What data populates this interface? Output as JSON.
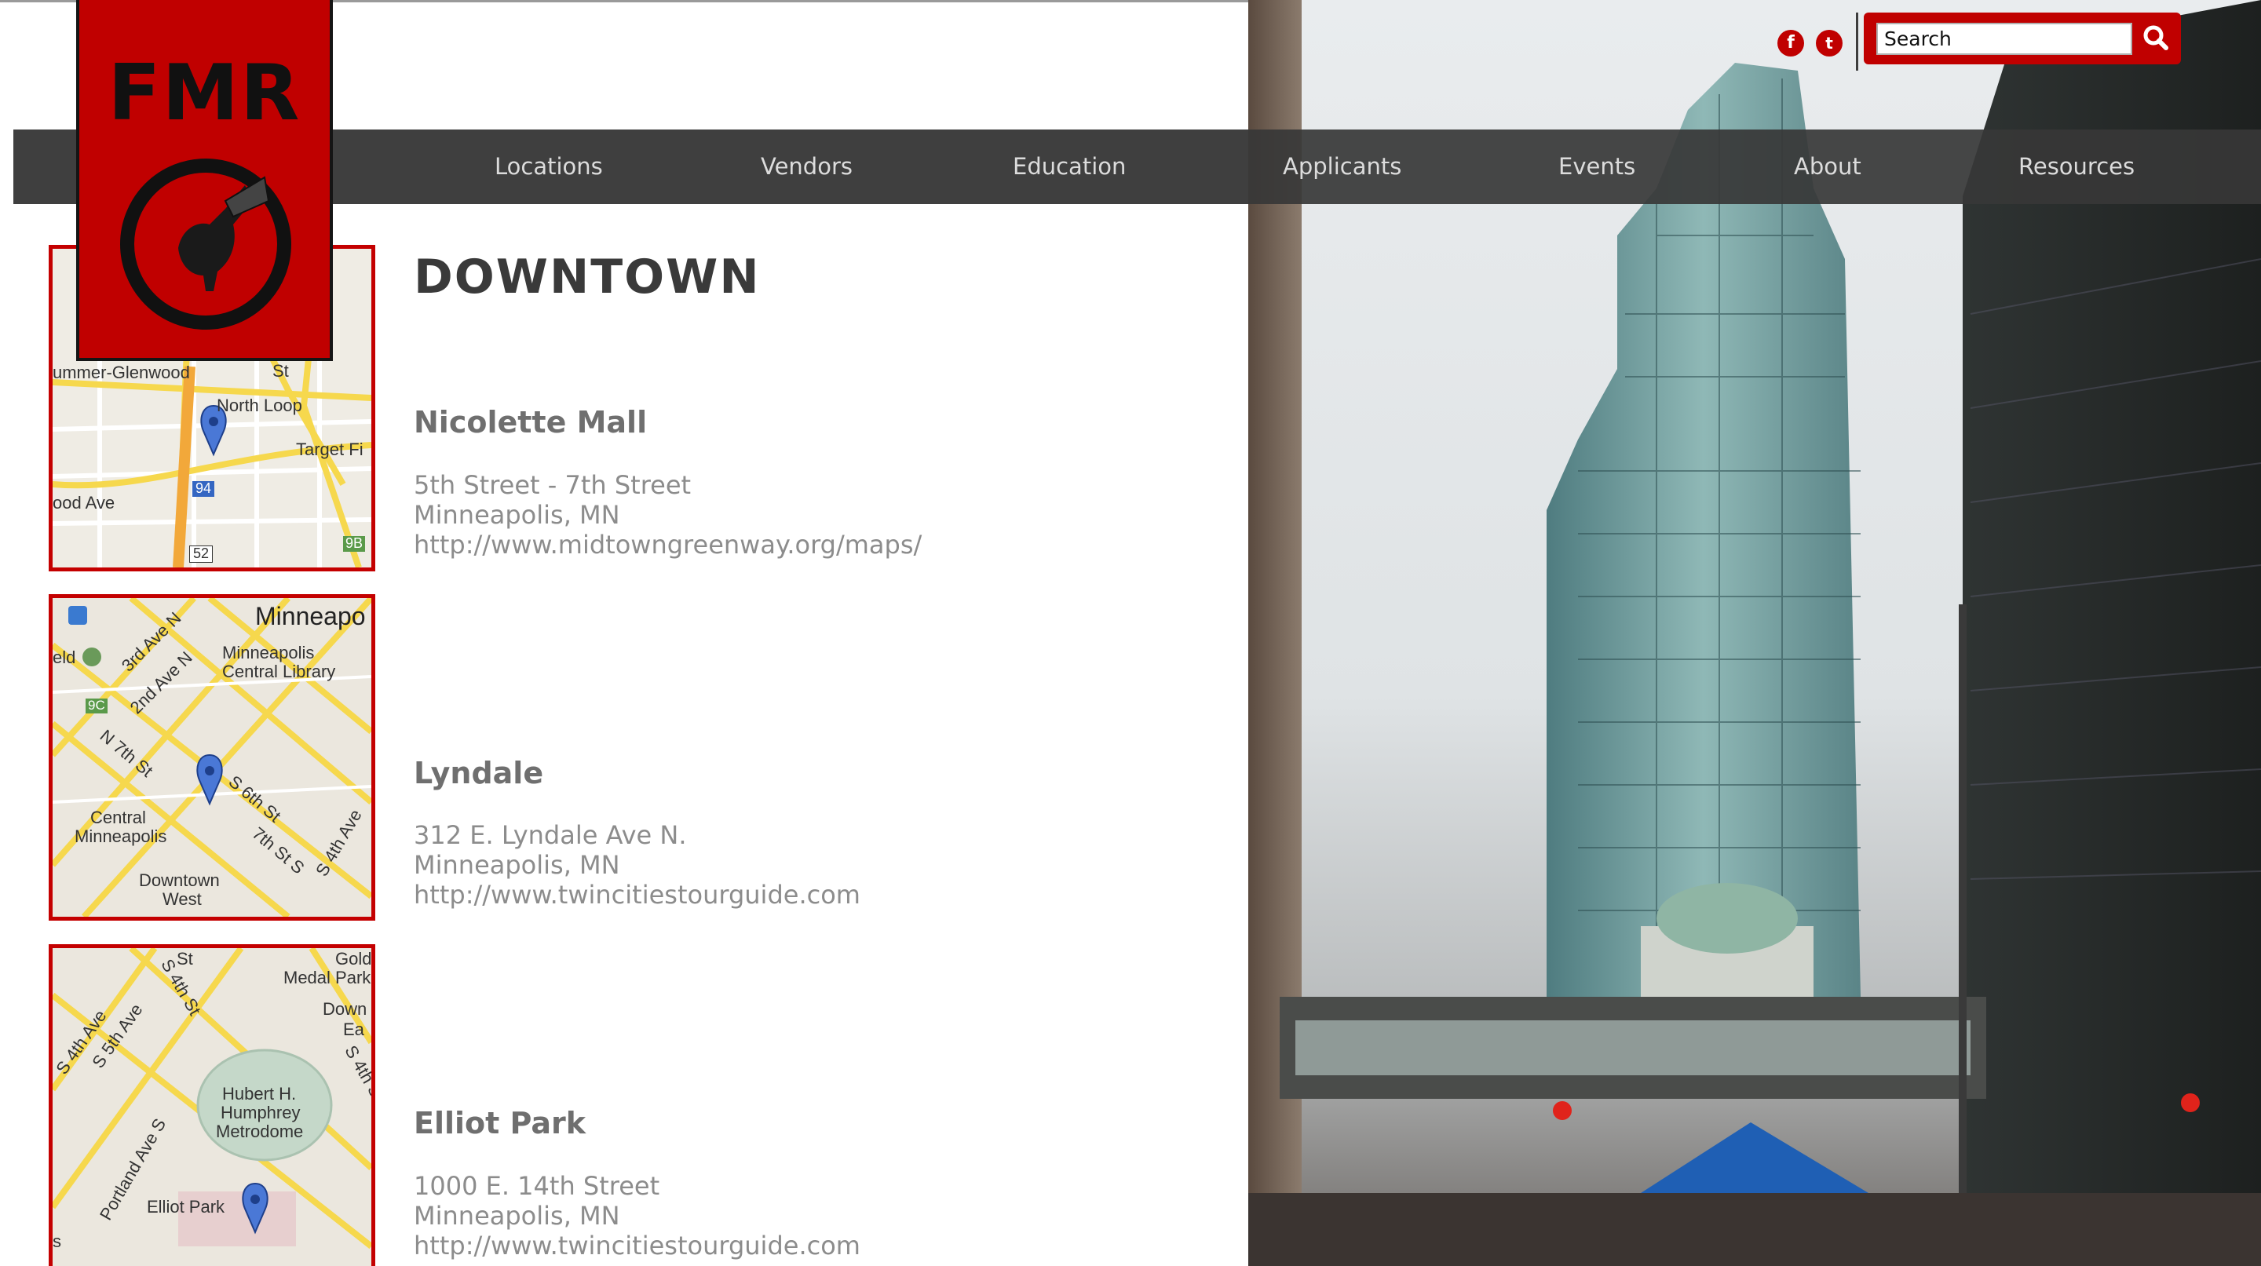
{
  "logo": {
    "text": "FMR"
  },
  "nav": {
    "items": [
      {
        "label": "Locations"
      },
      {
        "label": "Vendors"
      },
      {
        "label": "Education"
      },
      {
        "label": "Applicants"
      },
      {
        "label": "Events"
      },
      {
        "label": "About"
      },
      {
        "label": "Resources"
      }
    ]
  },
  "search": {
    "placeholder": "Search"
  },
  "social": {
    "facebook": "f",
    "twitter": "t"
  },
  "page": {
    "title": "DOWNTOWN"
  },
  "locations": [
    {
      "name": "Nicolette Mall",
      "address": "5th Street - 7th Street",
      "city": "Minneapolis, MN",
      "url": "http://www.midtowngreenway.org/maps/"
    },
    {
      "name": "Lyndale",
      "address": "312 E. Lyndale Ave N.",
      "city": "Minneapolis, MN",
      "url": "http://www.twincitiestourguide.com"
    },
    {
      "name": "Elliot Park",
      "address": "1000 E. 14th Street",
      "city": "Minneapolis, MN",
      "url": "http://www.twincitiestourguide.com"
    }
  ],
  "maps": [
    {
      "labels": [
        "ummer-Glenwood",
        "North Loop",
        "Target Fi",
        "ood Ave",
        "94",
        "52",
        "9B",
        "St"
      ]
    },
    {
      "labels": [
        "Minneapo",
        "Minneapolis",
        "Central Library",
        "eld",
        "9C",
        "3rd Ave N",
        "2nd Ave N",
        "N 7th St",
        "S 6th St",
        "Central",
        "Minneapolis",
        "7th St S",
        "S 4th Ave",
        "Downtown",
        "West"
      ]
    },
    {
      "labels": [
        "Gold",
        "Medal Park",
        "Down",
        "Ea",
        "S 4th St",
        "S 5th Ave",
        "S 4th Ave",
        "Hubert H.",
        "Humphrey",
        "Metrodome",
        "Portland Ave S",
        "Elliot Park",
        "St",
        "S 4th St",
        "s"
      ]
    }
  ],
  "colors": {
    "brand_red": "#c00000",
    "nav_bg": "#3f3f3f",
    "text_gray": "#8c8c8c"
  }
}
